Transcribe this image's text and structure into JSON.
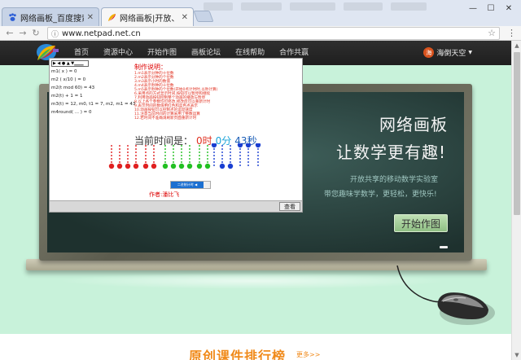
{
  "browser": {
    "tabs": [
      {
        "title": "网络画板_百度搜索"
      },
      {
        "title": "网络画板|开放、共享的"
      }
    ],
    "url": "www.netpad.net.cn"
  },
  "site": {
    "nav_links": [
      "首页",
      "资源中心",
      "开始作图",
      "画板论坛",
      "在线帮助",
      "合作共赢"
    ],
    "user_name": "海倒天空",
    "user_avatar": "海",
    "board": {
      "title_line1": "网络画板",
      "title_line2": "让数学更有趣!",
      "slogan1": "开放共享的移动数学实验室",
      "slogan2": "带您趣味学数学，更轻松，更快乐!",
      "start_button": "开始作图"
    },
    "applet": {
      "toolbar": "▶ ◀ ● ▲ ▼▁▁▁",
      "formulas": [
        "m1(  x  ) = 0",
        "m2 (  x/10  ) = 0",
        "m2(t mod 60) = 43",
        "m2(t) + 1 = 1",
        "m3(t) = 12, m0, t1 = 7, m2, m1 = 43",
        "m4round(  ... ) = 0"
      ],
      "instr_title": "制作说明：",
      "instructions": [
        "1.m1表示分钟的十位数",
        "2.m2表示分钟的个位数",
        "3.m3表示小时的数值",
        "4.m4表示秒钟的十位数",
        "5.m5表示秒钟的个位数(开始0点计时时,以秒计算)",
        "6.采用点的方式显示时间,按钮可以暂停和继续",
        "7.利用动画按钮控制整个动画的播放与暂停",
        "8.以上各个参数均可修改,修改后可以重新计时",
        "9.表示时间的数值用红色和蓝色点表示",
        "10.动画按钮可以控制点的运动速度",
        "11.注意当前时间的计算采用了整数运算",
        "12.若时间不准确请刷新页面重新计时"
      ],
      "time_label": "当前时间是：",
      "hours": "0时",
      "minutes": "0分",
      "seconds": "43秒",
      "slider_label": "二进制计时 ◀",
      "author": "作者:潘比飞",
      "view_button": "查看"
    },
    "rank_title": "原创课件排行榜",
    "rank_more": "更多>>"
  },
  "colors": {
    "site_bg": "#c8f2da",
    "nav_bg": "#262626",
    "board_bg": "#2b4642",
    "accent_orange": "#f08a1a",
    "bead_red": "#e02020",
    "bead_green": "#22c022",
    "bead_blue": "#1a3fd1"
  }
}
